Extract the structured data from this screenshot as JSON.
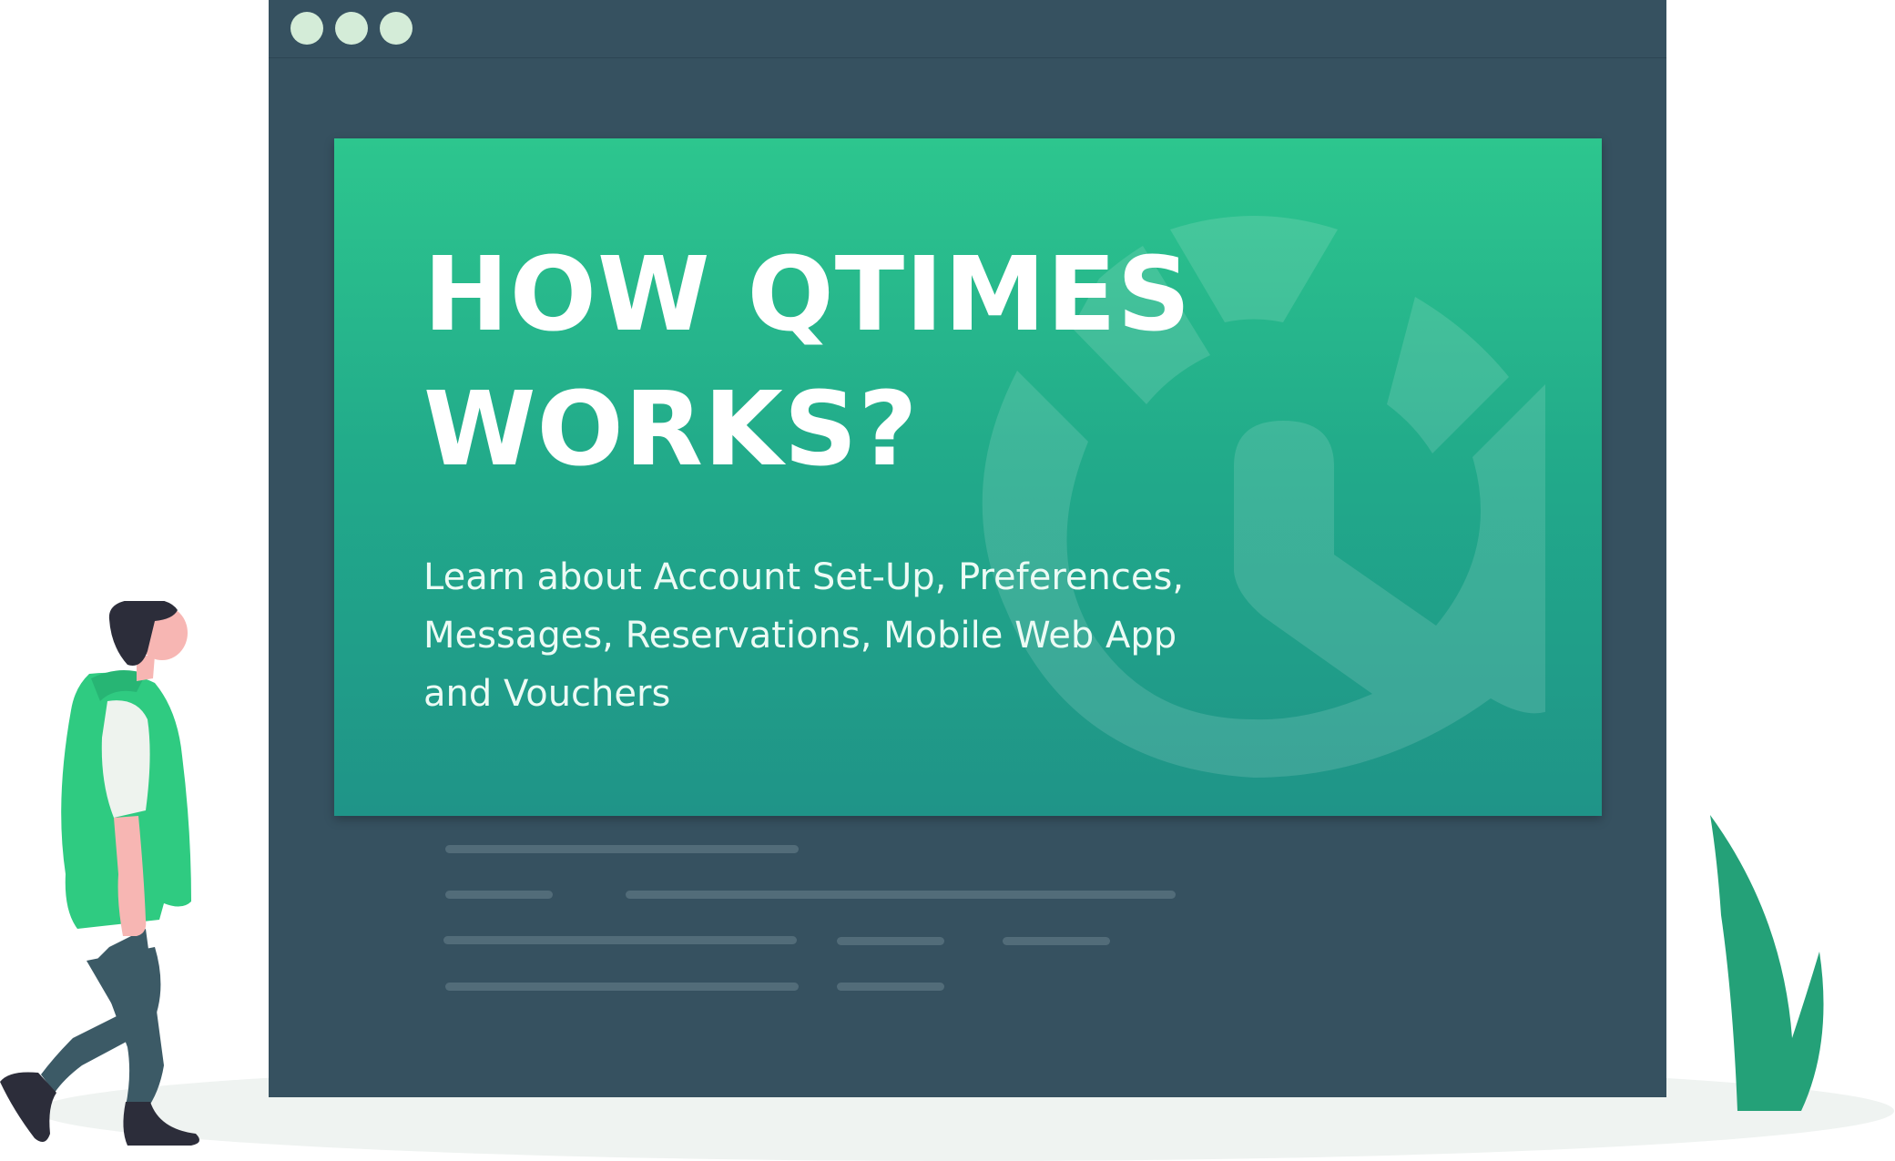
{
  "hero": {
    "title_line1": "HOW QTIMES",
    "title_line2": "WORKS?",
    "subtitle_line1": "Learn about Account Set-Up, Preferences,",
    "subtitle_line2": "Messages, Reservations, Mobile Web App",
    "subtitle_line3": "and Vouchers"
  },
  "icons": {
    "window_controls": [
      "window-dot",
      "window-dot",
      "window-dot"
    ],
    "watermark": "qtimes-logo-icon",
    "illustration": "person-illustration",
    "plant": "grass-illustration"
  },
  "colors": {
    "window": "#365160",
    "banner_top": "#2dc68e",
    "banner_bottom": "#1f9488",
    "accent_green": "#2fcb81",
    "placeholder": "#526c79"
  }
}
